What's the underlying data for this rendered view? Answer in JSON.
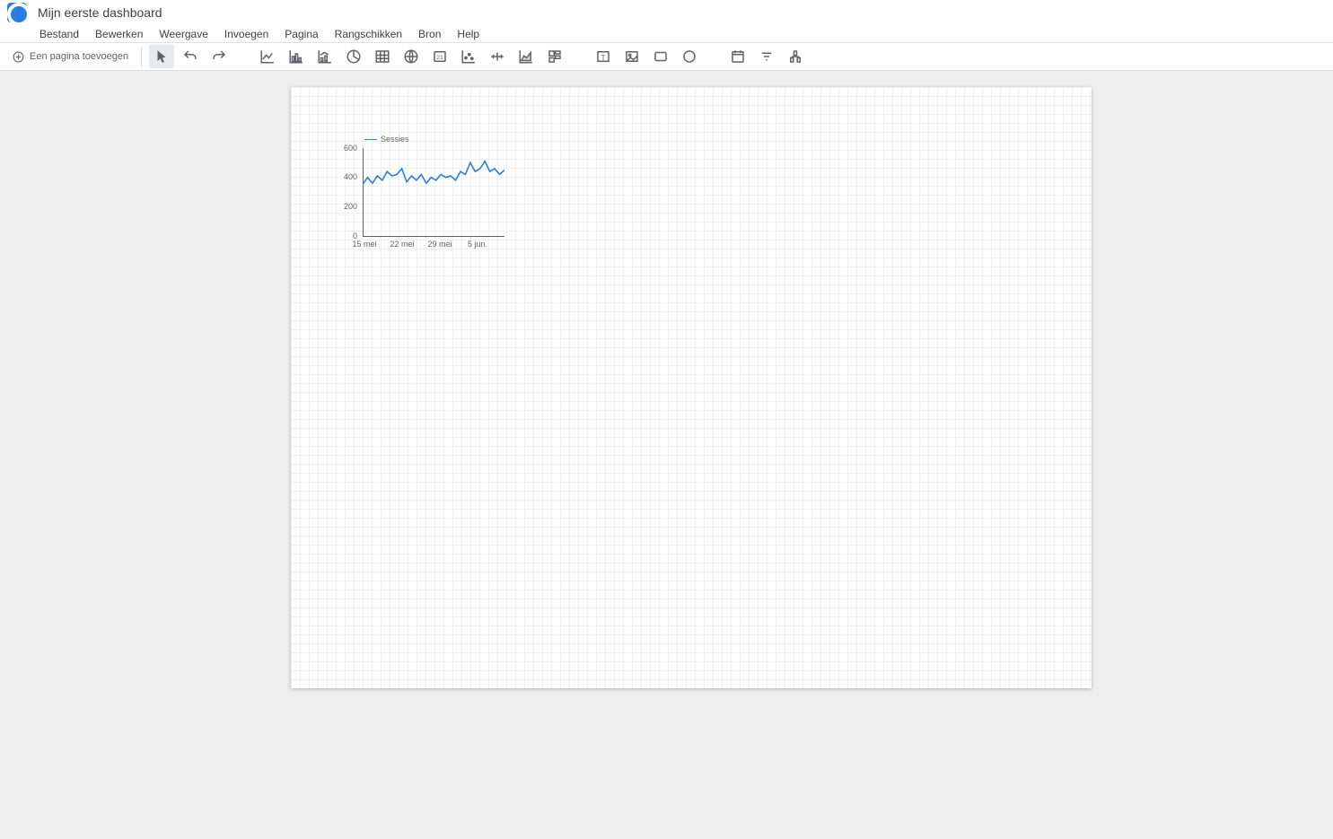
{
  "header": {
    "title": "Mijn eerste dashboard"
  },
  "menu": [
    "Bestand",
    "Bewerken",
    "Weergave",
    "Invoegen",
    "Pagina",
    "Rangschikken",
    "Bron",
    "Help"
  ],
  "toolbar": {
    "add_page_label": "Een pagina toevoegen"
  },
  "chart_data": {
    "type": "line",
    "legend": "Sessies",
    "ylim": [
      0,
      600
    ],
    "yticks": [
      0,
      200,
      400,
      600
    ],
    "xticks": [
      "15 mei",
      "22 mei",
      "29 mei",
      "5 jun."
    ],
    "series": [
      {
        "name": "Sessies",
        "values": [
          350,
          400,
          360,
          410,
          380,
          440,
          410,
          420,
          460,
          370,
          410,
          380,
          420,
          360,
          400,
          380,
          420,
          400,
          410,
          380,
          440,
          420,
          500,
          440,
          460,
          510,
          440,
          460,
          420,
          450
        ]
      }
    ]
  }
}
